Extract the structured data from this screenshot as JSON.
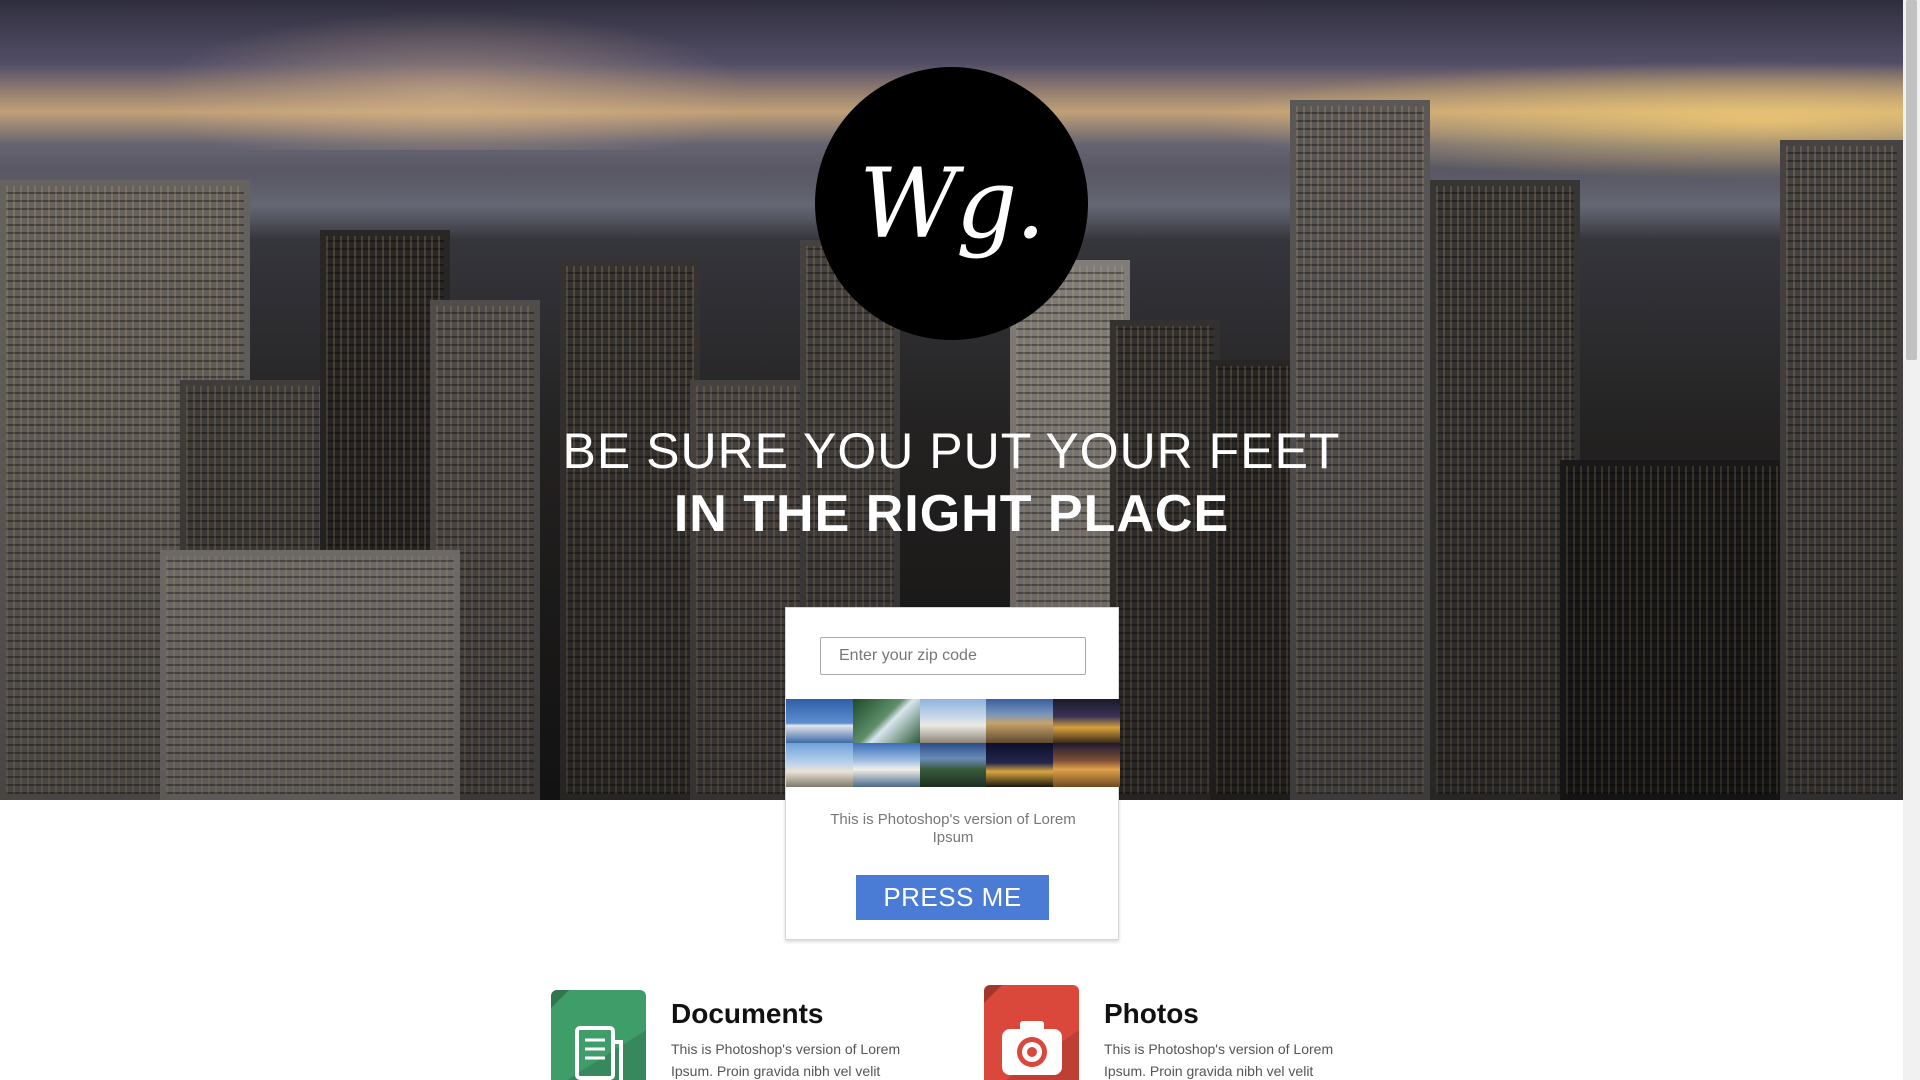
{
  "hero": {
    "logo_text": "Wg.",
    "headline_line1": "BE SURE YOU PUT YOUR FEET",
    "headline_line2": "IN THE RIGHT PLACE",
    "background": "city-skyline-photo"
  },
  "search_card": {
    "zip_placeholder": "Enter your zip code",
    "zip_value": "",
    "thumbnails": [
      "sydney-opera-house",
      "waterfall",
      "sacre-coeur",
      "colosseum",
      "louvre-pyramid",
      "leaning-tower-of-pisa",
      "taj-mahal",
      "mountain-valley",
      "eiffel-tower-night",
      "pyramids-of-giza"
    ],
    "caption": "This is Photoshop's version of Lorem Ipsum",
    "button_label": "PRESS ME",
    "button_color": "#4a7bd5"
  },
  "features": [
    {
      "title": "Documents",
      "text": "This is Photoshop's version of Lorem Ipsum. Proin gravida nibh vel velit",
      "icon": "document-icon",
      "color": "#3f9d6a"
    },
    {
      "title": "Photos",
      "text": "This is Photoshop's version of Lorem Ipsum. Proin gravida nibh vel velit",
      "icon": "camera-icon",
      "color": "#d9483b"
    }
  ]
}
